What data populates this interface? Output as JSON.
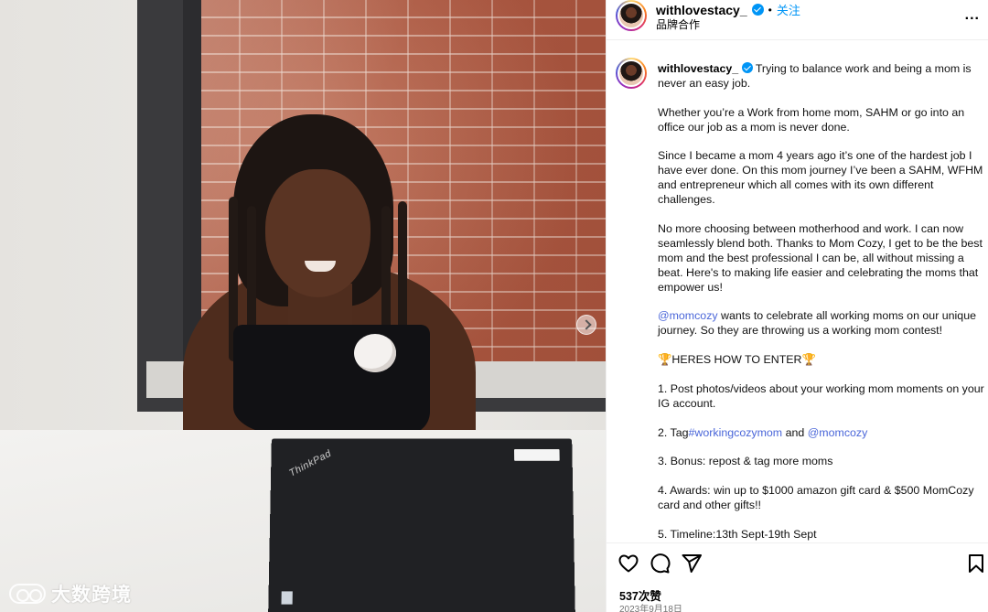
{
  "post": {
    "username": "withlovestacy_",
    "dot": "•",
    "follow": "关注",
    "subtitle": "品牌合作",
    "more": "..."
  },
  "caption": {
    "username": "withlovestacy_",
    "intro": "Trying to balance work and being a mom is never an easy job.",
    "p2": "Whether you’re a Work from home mom, SAHM or go into an office our job as a mom is never done.",
    "p3": "Since I became a mom 4 years ago it’s one of the hardest job I have ever done. On this mom journey I’ve been a SAHM, WFHM and entrepreneur which all comes with its own different challenges.",
    "p4": "No more choosing between motherhood and work. I can now seamlessly blend both. Thanks to Mom Cozy, I get to be the best mom and the best professional I can be, all without missing a beat. Here's to making life easier and celebrating the moms that empower us!",
    "p5_mention": "@momcozy",
    "p5_text": " wants to celebrate all working moms on our unique journey. So they are throwing us a working mom contest!",
    "p6": "🏆HERES HOW TO ENTER🏆",
    "p7": "1. Post photos/videos about your working mom moments on your IG account.",
    "p8_prefix": "2. Tag",
    "p8_hashtag": "#workingcozymom",
    "p8_and": " and ",
    "p8_mention": "@momcozy",
    "p9": "3. Bonus: repost & tag more moms",
    "p10": "4. Awards: win up to $1000 amazon gift card & $500 MomCozy card and other gifts!!",
    "p11": "5. Timeline:13th Sept-19th Sept"
  },
  "footer": {
    "likes": "537次赞",
    "date": "2023年9月18日"
  },
  "photo": {
    "laptop_brand": "ThinkPad",
    "watermark": "大数跨境"
  },
  "icons": {
    "like": "heart-icon",
    "comment": "comment-icon",
    "share": "send-icon",
    "save": "bookmark-icon",
    "verified": "verified-badge-icon",
    "next": "chevron-right-icon"
  },
  "colors": {
    "link": "#385898",
    "follow": "#0095f6",
    "verified": "#0095f6"
  }
}
